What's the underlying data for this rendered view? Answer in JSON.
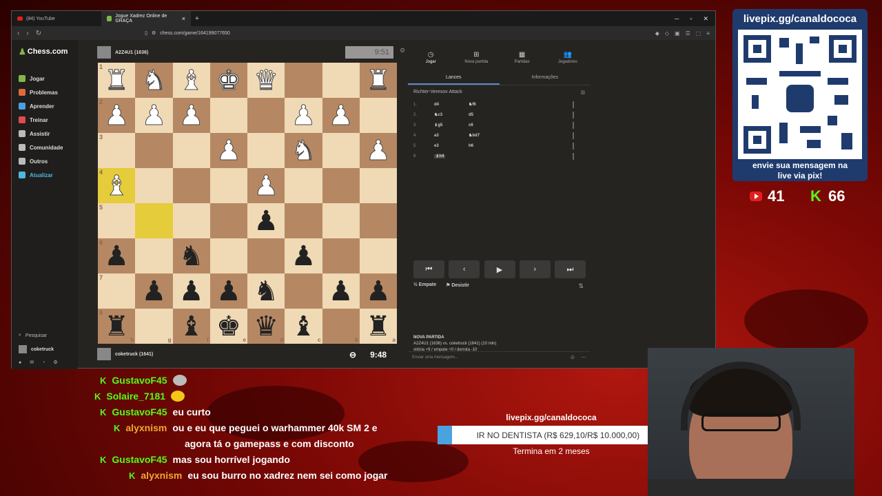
{
  "browser": {
    "tabs": [
      {
        "label": "(84) YouTube",
        "active": false
      },
      {
        "label": "Jogue Xadrez Online de GRAÇA",
        "active": true
      }
    ],
    "url": "chess.com/game/164199077650"
  },
  "sidebar": {
    "logo": "Chess.com",
    "items": [
      {
        "label": "Jogar",
        "color": "#81b64c"
      },
      {
        "label": "Problemas",
        "color": "#e0683b"
      },
      {
        "label": "Aprender",
        "color": "#4c9fe0"
      },
      {
        "label": "Treinar",
        "color": "#e04c4c"
      },
      {
        "label": "Assistir",
        "color": "#bbbbbb"
      },
      {
        "label": "Comunidade",
        "color": "#bbbbbb"
      },
      {
        "label": "Outros",
        "color": "#bbbbbb"
      },
      {
        "label": "Atualizar",
        "color": "#4cb8e0"
      }
    ],
    "search_label": "Pesquisar",
    "user": "coketruck"
  },
  "game": {
    "top_player": "A2Z4U1 (1636)",
    "top_clock": "9:51",
    "bottom_player": "coketruck (1641)",
    "bottom_clock": "9:48",
    "board": [
      [
        "wR",
        "wN",
        "wB",
        "wK",
        "wQ",
        "",
        "",
        "wR"
      ],
      [
        "wP",
        "wP",
        "wP",
        "",
        "",
        "wP",
        "wP",
        ""
      ],
      [
        "",
        "",
        "",
        "wP",
        "",
        "wN",
        "",
        "wP"
      ],
      [
        "wB",
        "",
        "",
        "",
        "wP",
        "",
        "",
        ""
      ],
      [
        "",
        "",
        "",
        "",
        "bP",
        "",
        "",
        ""
      ],
      [
        "bP",
        "",
        "bN",
        "",
        "",
        "bP",
        "",
        ""
      ],
      [
        "",
        "bP",
        "bP",
        "bP",
        "bN",
        "",
        "bP",
        "bP"
      ],
      [
        "bR",
        "",
        "bB",
        "bK",
        "bQ",
        "bB",
        "",
        "bR"
      ]
    ],
    "ranks": [
      "1",
      "2",
      "3",
      "4",
      "5",
      "6",
      "7",
      "8"
    ],
    "files": [
      "h",
      "g",
      "f",
      "e",
      "d",
      "c",
      "b",
      "a"
    ],
    "highlight": [
      [
        3,
        0
      ],
      [
        4,
        1
      ]
    ]
  },
  "panel": {
    "tabs": [
      {
        "label": "Jogar",
        "icon": "clock-icon"
      },
      {
        "label": "Nova partida",
        "icon": "plus-icon"
      },
      {
        "label": "Partidas",
        "icon": "grid-icon"
      },
      {
        "label": "Jogadores",
        "icon": "users-icon"
      }
    ],
    "subtabs": [
      "Lances",
      "Informações"
    ],
    "opening": "Richter-Veresov Attack",
    "moves": [
      {
        "num": "1.",
        "w": "d4",
        "b": "♞f6"
      },
      {
        "num": "2.",
        "w": "♞c3",
        "b": "d5"
      },
      {
        "num": "3.",
        "w": "♝g5",
        "b": "c6"
      },
      {
        "num": "4.",
        "w": "a3",
        "b": "♞bd7"
      },
      {
        "num": "5.",
        "w": "e3",
        "b": "h6"
      },
      {
        "num": "6.",
        "w": "♝h4",
        "b": ""
      }
    ],
    "actions": {
      "draw": "Empate",
      "resign": "Desistir"
    },
    "new_game": {
      "title": "NOVA PARTIDA",
      "line1": "A2Z4U1 (1636) vs. coketruck (1641) (10 min)",
      "line2": "vitória +9 / empate +0 / derrota -10"
    },
    "chat_placeholder": "Enviar uma mensagem..."
  },
  "overlay": {
    "qr_title": "livepix.gg/canaldococa",
    "qr_subtitle_1": "envie sua mensagem na",
    "qr_subtitle_2": "live via pix!",
    "youtube_count": "41",
    "kick_count": "66",
    "goal_url": "livepix.gg/canaldococa",
    "goal_text": "IR NO DENTISTA (R$ 629,10/R$ 10.000,00)",
    "goal_progress": 0.063,
    "goal_end": "Termina em 2 meses"
  },
  "chat": [
    {
      "user": "GustavoF45",
      "msg": "",
      "emote": "gray",
      "color": "green"
    },
    {
      "user": "Solaire_7181",
      "msg": "",
      "emote": "yellow",
      "color": "green"
    },
    {
      "user": "GustavoF45",
      "msg": "eu curto",
      "color": "green"
    },
    {
      "user": "alyxnism",
      "msg": "ou e eu que peguei o warhammer 40k SM 2 e",
      "color": "orange"
    },
    {
      "user": "",
      "msg": "agora tá o gamepass e com disconto",
      "color": "orange"
    },
    {
      "user": "GustavoF45",
      "msg": "mas sou horrível jogando",
      "color": "green"
    },
    {
      "user": "alyxnism",
      "msg": "eu sou burro no xadrez nem sei como jogar",
      "color": "orange"
    }
  ]
}
